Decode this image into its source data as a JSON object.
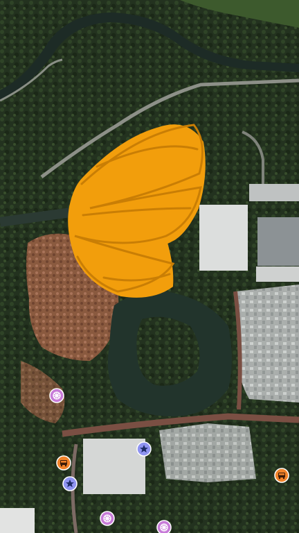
{
  "map": {
    "view": "satellite",
    "scribble_color": "#F29E0C"
  },
  "markers": [
    {
      "type": "ride",
      "icon": "ferris-wheel-icon",
      "color": "#C77BD8"
    },
    {
      "type": "show",
      "icon": "star-icon",
      "color": "#8F94F2"
    },
    {
      "type": "show",
      "icon": "star-icon",
      "color": "#8F94F2"
    },
    {
      "type": "transport",
      "icon": "bus-icon",
      "color": "#F0822A"
    },
    {
      "type": "transport",
      "icon": "bus-icon",
      "color": "#F0822A"
    },
    {
      "type": "ride",
      "icon": "ferris-wheel-icon",
      "color": "#C77BD8"
    },
    {
      "type": "ride",
      "icon": "ferris-wheel-icon",
      "color": "#C77BD8"
    }
  ]
}
